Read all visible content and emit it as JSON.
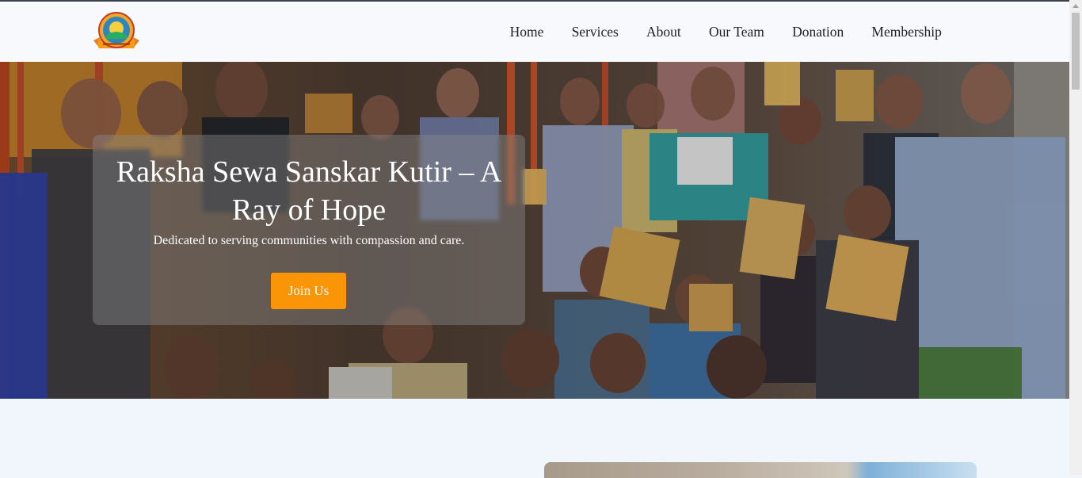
{
  "nav": {
    "logo_name": "organization-logo",
    "links": [
      "Home",
      "Services",
      "About",
      "Our Team",
      "Donation",
      "Membership"
    ]
  },
  "hero": {
    "title": "Raksha Sewa Sanskar Kutir – A Ray of Hope",
    "subtitle": "Dedicated to serving communities with compassion and care.",
    "cta_label": "Join Us"
  },
  "colors": {
    "accent": "#fa9507",
    "page_bg": "#f1f6fd",
    "nav_bg": "#f7f9fc"
  }
}
